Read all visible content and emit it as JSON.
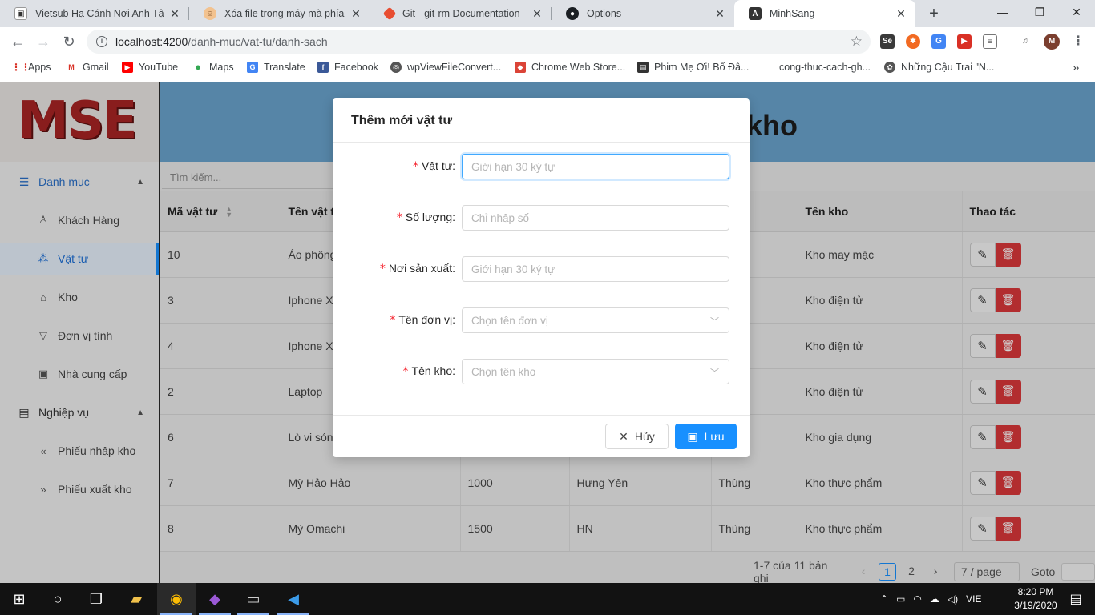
{
  "browser": {
    "tabs": [
      {
        "title": "Vietsub Hạ Cánh Nơi Anh Tập",
        "icon": "video-page-icon"
      },
      {
        "title": "Xóa file trong máy mà phía trên",
        "icon": "person-face-icon"
      },
      {
        "title": "Git - git-rm Documentation",
        "icon": "git-logo-icon"
      },
      {
        "title": "Options",
        "icon": "github-logo-icon"
      },
      {
        "title": "MinhSang",
        "icon": "angular-logo-icon"
      }
    ],
    "url_host": "localhost:4200",
    "url_path": "/danh-muc/vat-tu/danh-sach",
    "profile_initial": "M",
    "bookmarks": [
      {
        "label": "Apps"
      },
      {
        "label": "Gmail"
      },
      {
        "label": "YouTube"
      },
      {
        "label": "Maps"
      },
      {
        "label": "Translate"
      },
      {
        "label": "Facebook"
      },
      {
        "label": "wpViewFileConvert..."
      },
      {
        "label": "Chrome Web Store..."
      },
      {
        "label": "Phim Mẹ Ơi! Bố Đâ..."
      },
      {
        "label": "cong-thuc-cach-gh..."
      },
      {
        "label": "Những Cậu Trai \"N..."
      }
    ],
    "bookmarks_more": "»"
  },
  "app": {
    "logo": "MSE",
    "banner_title_fragment": "kho",
    "sidebar": {
      "group1": "Danh mục",
      "items1": [
        "Khách Hàng",
        "Vật tư",
        "Kho",
        "Đơn vị tính",
        "Nhà cung cấp"
      ],
      "group2": "Nghiệp vụ",
      "items2": [
        "Phiếu nhập kho",
        "Phiếu xuất kho"
      ]
    },
    "search_placeholder": "Tìm kiếm...",
    "table": {
      "headers": [
        "Mã vật tư",
        "Tên vật tư",
        "",
        "",
        "",
        "Tên kho",
        "Thao tác"
      ],
      "rows": [
        [
          "10",
          "Áo phông",
          "",
          "",
          "",
          "Kho may mặc"
        ],
        [
          "3",
          "Iphone X",
          "",
          "",
          "",
          "Kho điện tử"
        ],
        [
          "4",
          "Iphone X",
          "",
          "",
          "",
          "Kho điện tử"
        ],
        [
          "2",
          "Laptop",
          "",
          "",
          "",
          "Kho điện tử"
        ],
        [
          "6",
          "Lò vi sóng",
          "",
          "",
          "",
          "Kho gia dụng"
        ],
        [
          "7",
          "Mỳ Hảo Hảo",
          "1000",
          "Hưng Yên",
          "Thùng",
          "Kho thực phẩm"
        ],
        [
          "8",
          "Mỳ Omachi",
          "1500",
          "HN",
          "Thùng",
          "Kho thực phẩm"
        ]
      ]
    },
    "pager": {
      "summary": "1-7 của 11 bản ghi",
      "pages": [
        "1",
        "2"
      ],
      "current": "1",
      "page_size": "7 / page",
      "goto": "Goto"
    }
  },
  "modal": {
    "title": "Thêm mới vật tư",
    "fields": [
      {
        "label": "Vật tư:",
        "placeholder": "Giới hạn 30 ký tự",
        "value": ""
      },
      {
        "label": "Số lượng:",
        "placeholder": "Chỉ nhập số",
        "value": ""
      },
      {
        "label": "Nơi sản xuất:",
        "placeholder": "Giới hạn 30 ký tự",
        "value": ""
      },
      {
        "label": "Tên đơn vị:",
        "placeholder": "Chọn tên đơn vị",
        "value": ""
      },
      {
        "label": "Tên kho:",
        "placeholder": "Chọn tên kho",
        "value": ""
      }
    ],
    "cancel_label": "Hủy",
    "save_label": "Lưu"
  },
  "taskbar": {
    "language": "VIE",
    "time": "8:20 PM",
    "date": "3/19/2020"
  },
  "colors": {
    "primary": "#1890ff",
    "danger": "#d9383a",
    "banner": "#6aa3cc",
    "logo_red": "#a82424"
  }
}
